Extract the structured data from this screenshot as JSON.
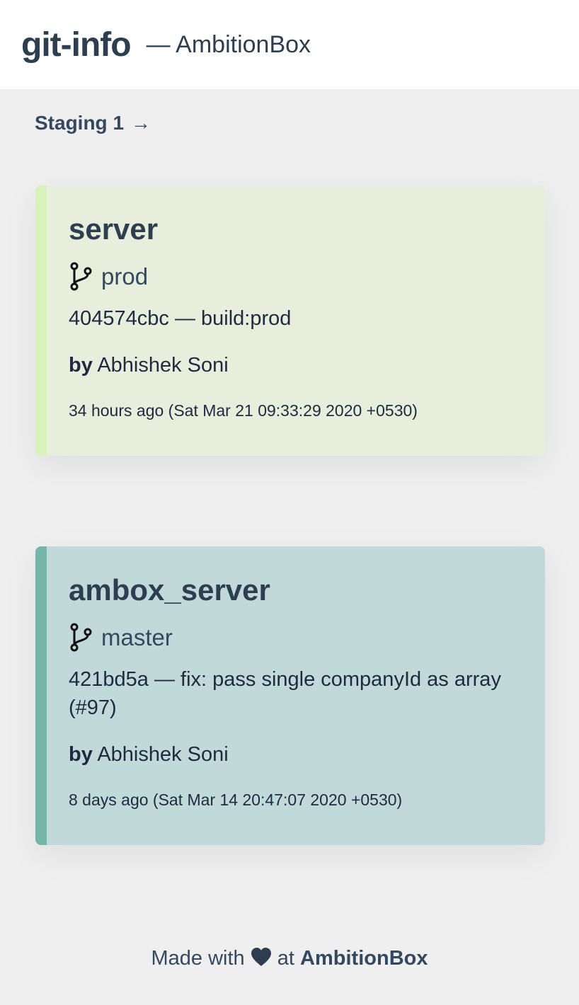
{
  "header": {
    "title": "git-info",
    "subtitle": "— AmbitionBox"
  },
  "environment": {
    "label": "Staging 1",
    "arrow": "→"
  },
  "repos": [
    {
      "name": "server",
      "branch": "prod",
      "commit": "404574cbc — build:prod",
      "by_label": "by",
      "author": "Abhishek Soni",
      "time": "34 hours ago (Sat Mar 21 09:33:29 2020 +0530)",
      "accent_color": "#d8f2bb",
      "bg_color": "#e7efdc"
    },
    {
      "name": "ambox_server",
      "branch": "master",
      "commit": "421bd5a — fix: pass single companyId as array (#97)",
      "by_label": "by",
      "author": "Abhishek Soni",
      "time": "8 days ago (Sat Mar 14 20:47:07 2020 +0530)",
      "accent_color": "#74b7a9",
      "bg_color": "#c1dad9"
    }
  ],
  "footer": {
    "prefix": "Made with",
    "icon": "heart-icon",
    "middle": "at",
    "brand": "AmbitionBox"
  }
}
